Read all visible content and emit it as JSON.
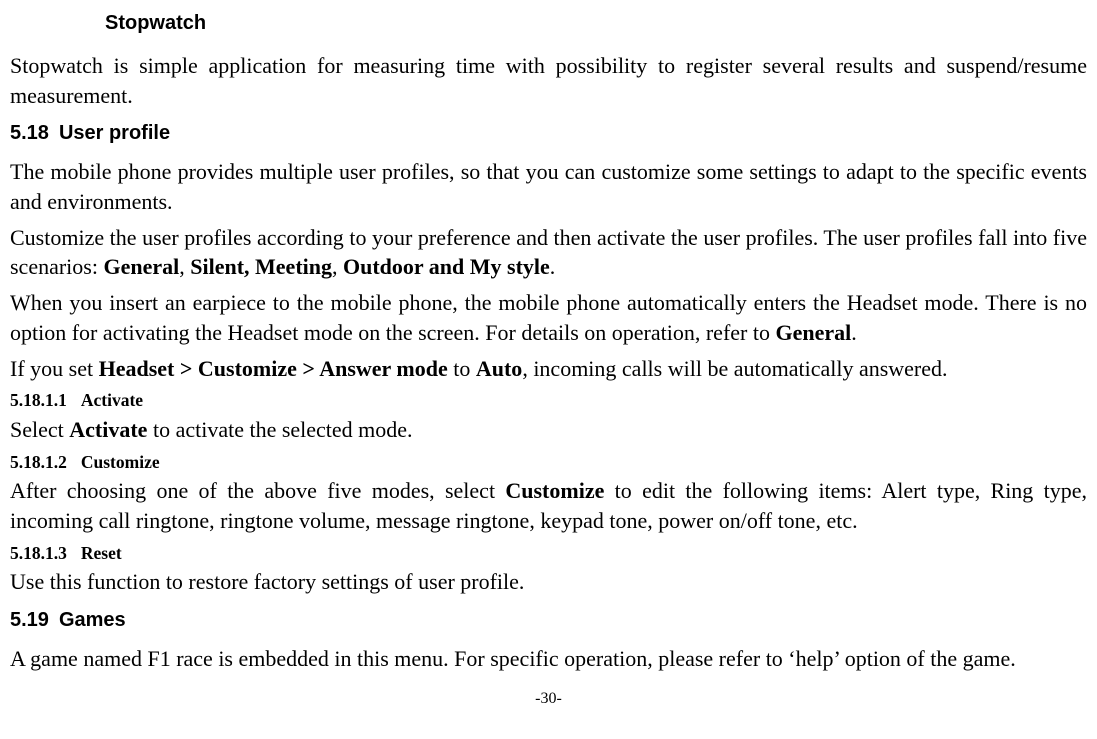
{
  "stopwatch": {
    "title": "Stopwatch",
    "desc": "Stopwatch is simple application for measuring time with possibility to register several results and suspend/resume measurement."
  },
  "userProfile": {
    "number": "5.18",
    "title": "User profile",
    "p1": "The mobile phone provides multiple user profiles, so that you can customize some settings to adapt to the specific events and environments.",
    "p2a": "Customize the user profiles according to your preference and then activate the user profiles. The user profiles fall into five scenarios: ",
    "p2b": "General",
    "p2c": ", ",
    "p2d": "Silent, Meeting",
    "p2e": ", ",
    "p2f": "Outdoor and My style",
    "p2g": ".",
    "p3a": "When you insert an earpiece to the mobile phone, the mobile phone automatically enters the Headset mode. There is no option for activating the Headset mode on the screen. For details on operation, refer to ",
    "p3b": "General",
    "p3c": ".",
    "p4a": "If you set ",
    "p4b": "Headset > Customize > Answer mode",
    "p4c": " to ",
    "p4d": "Auto",
    "p4e": ", incoming calls will be automatically answered.",
    "activate": {
      "number": "5.18.1.1",
      "title": "Activate",
      "text_a": "Select ",
      "text_b": "Activate",
      "text_c": " to activate the selected mode."
    },
    "customize": {
      "number": "5.18.1.2",
      "title": "Customize",
      "text_a": "After choosing one of the above five modes, select ",
      "text_b": "Customize",
      "text_c": " to edit the following items: Alert type, Ring type, incoming call ringtone, ringtone volume, message ringtone, keypad tone, power on/off tone, etc."
    },
    "reset": {
      "number": "5.18.1.3",
      "title": "Reset",
      "text": "Use this function to restore factory settings of user profile."
    }
  },
  "games": {
    "number": "5.19",
    "title": "Games",
    "text": "A game named F1 race is embedded in this menu. For specific operation, please refer to ‘help’ option of the game."
  },
  "pageNumber": "-30-"
}
